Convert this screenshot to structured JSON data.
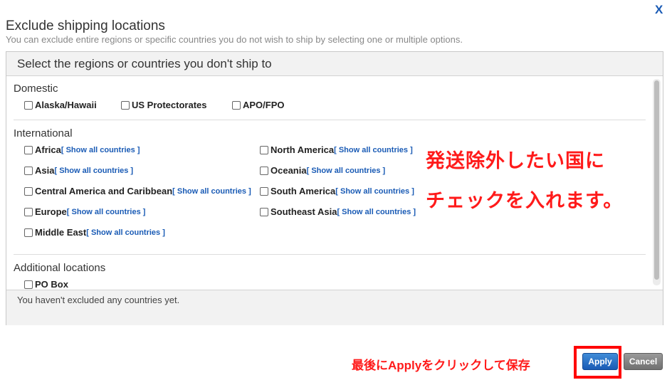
{
  "dialog": {
    "close_label": "X",
    "title": "Exclude shipping locations",
    "subtitle": "You can exclude entire regions or specific countries you do not wish to ship by selecting one or multiple options."
  },
  "panel": {
    "heading": "Select the regions or countries you don't ship to",
    "domestic": {
      "title": "Domestic",
      "options": [
        "Alaska/Hawaii",
        "US Protectorates",
        "APO/FPO"
      ]
    },
    "international": {
      "title": "International",
      "show_all_label": "[ Show all countries ]",
      "left": [
        "Africa",
        "Asia",
        "Central America and Caribbean",
        "Europe",
        "Middle East"
      ],
      "right": [
        "North America",
        "Oceania",
        "South America",
        "Southeast Asia"
      ]
    },
    "additional": {
      "title": "Additional locations",
      "options": [
        "PO Box"
      ]
    },
    "status": "You haven't excluded any countries yet."
  },
  "annotations": {
    "line1": "発送除外したい国に",
    "line2": "チェックを入れます。",
    "bottom": "最後にApplyをクリックして保存"
  },
  "buttons": {
    "apply": "Apply",
    "cancel": "Cancel"
  },
  "colors": {
    "link": "#1a5bb5",
    "annotation": "#ff1a1a",
    "apply_bg": "#1a5bb5",
    "cancel_bg": "#707070"
  }
}
